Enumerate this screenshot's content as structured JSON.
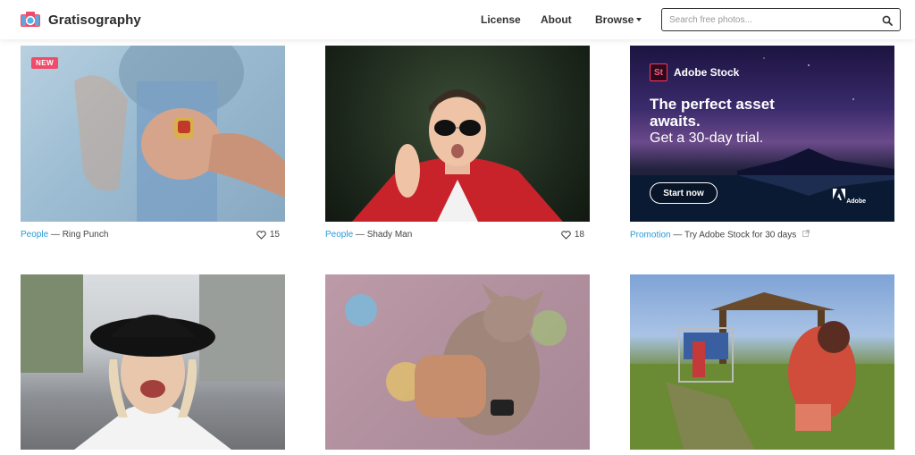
{
  "brand": {
    "name": "Gratisography",
    "colors": {
      "red": "#ef4b6a",
      "blue": "#2a9ad6"
    }
  },
  "nav": {
    "license": "License",
    "about": "About",
    "browse": "Browse"
  },
  "search": {
    "placeholder": "Search free photos..."
  },
  "cards": [
    {
      "badge": "NEW",
      "category": "People",
      "title": "Ring Punch",
      "likes": "15"
    },
    {
      "category": "People",
      "title": "Shady Man",
      "likes": "18"
    },
    {
      "category": "Promotion",
      "title": "Try Adobe Stock for 30 days",
      "ad": {
        "logo": "St",
        "brand": "Adobe Stock",
        "headline": "The perfect asset awaits.",
        "subline": "Get a 30-day trial.",
        "button": "Start now",
        "adobe_label": "Adobe"
      }
    },
    {
      "description": "Smiling woman in black hat"
    },
    {
      "description": "Man in floral shirt holding hairless cat"
    },
    {
      "description": "Woman with shopping cart in park"
    }
  ],
  "separator": "—"
}
